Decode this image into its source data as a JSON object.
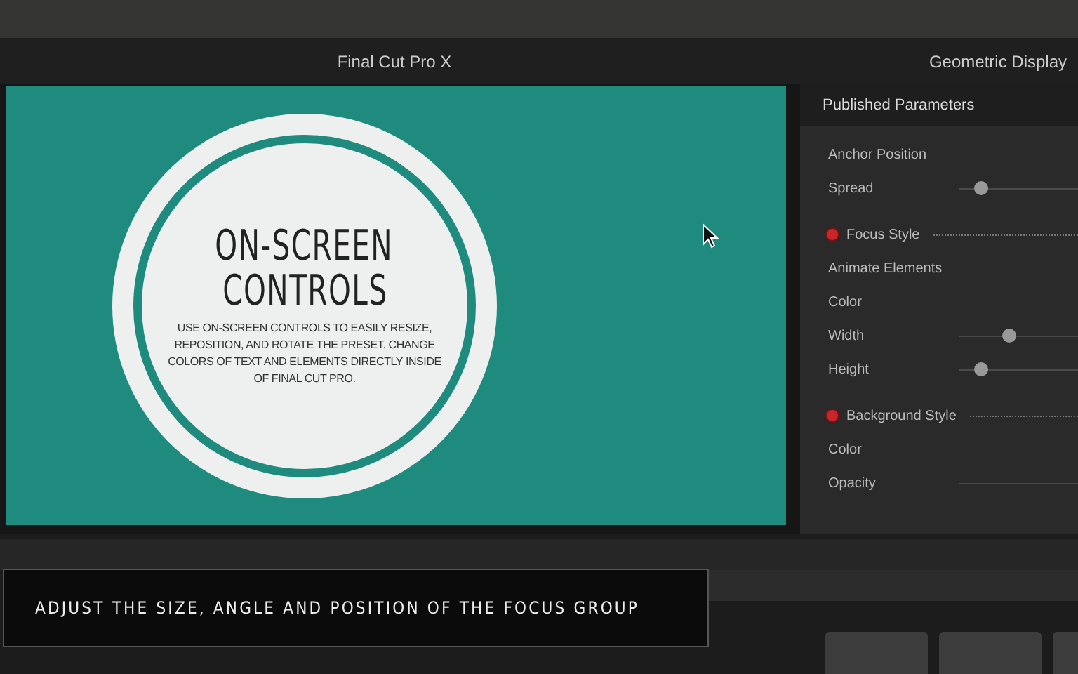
{
  "window": {
    "title": "Final Cut Pro X"
  },
  "inspector_title": "Geometric Display",
  "viewer": {
    "title_line_1": "ON-SCREEN",
    "title_line_2": "CONTROLS",
    "body": "USE ON-SCREEN CONTROLS TO EASILY RESIZE, REPOSITION, AND ROTATE THE PRESET. CHANGE COLORS OF TEXT AND ELEMENTS DIRECTLY INSIDE OF FINAL CUT PRO."
  },
  "parameters": {
    "title": "Published Parameters",
    "rows": [
      {
        "kind": "label",
        "label": "Anchor Position"
      },
      {
        "kind": "slider",
        "label": "Spread",
        "level": 0.19
      },
      {
        "kind": "section",
        "label": "Focus Style"
      },
      {
        "kind": "label",
        "label": "Animate Elements"
      },
      {
        "kind": "label",
        "label": "Color"
      },
      {
        "kind": "slider",
        "label": "Width",
        "level": 0.42
      },
      {
        "kind": "slider",
        "label": "Height",
        "level": 0.19
      },
      {
        "kind": "section",
        "label": "Background Style"
      },
      {
        "kind": "label",
        "label": "Color"
      },
      {
        "kind": "track",
        "label": "Opacity"
      }
    ]
  },
  "caption": "ADJUST THE SIZE, ANGLE AND POSITION OF THE FOCUS GROUP"
}
